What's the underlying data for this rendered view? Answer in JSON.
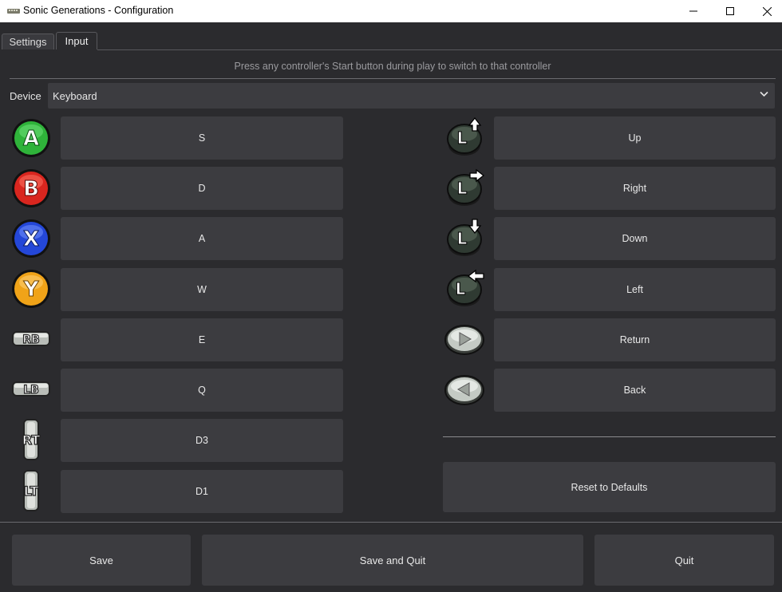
{
  "window": {
    "title": "Sonic Generations - Configuration"
  },
  "tabs": [
    {
      "label": "Settings"
    },
    {
      "label": "Input"
    }
  ],
  "hint": "Press any controller's Start button during play to switch to that controller",
  "device": {
    "label": "Device",
    "value": "Keyboard"
  },
  "left_bindings": [
    {
      "icon": "a-button-icon",
      "key": "S"
    },
    {
      "icon": "b-button-icon",
      "key": "D"
    },
    {
      "icon": "x-button-icon",
      "key": "A"
    },
    {
      "icon": "y-button-icon",
      "key": "W"
    },
    {
      "icon": "rb-bumper-icon",
      "key": "E"
    },
    {
      "icon": "lb-bumper-icon",
      "key": "Q"
    },
    {
      "icon": "rt-trigger-icon",
      "key": "D3"
    },
    {
      "icon": "lt-trigger-icon",
      "key": "D1"
    }
  ],
  "right_bindings": [
    {
      "icon": "left-stick-up-icon",
      "key": "Up"
    },
    {
      "icon": "left-stick-right-icon",
      "key": "Right"
    },
    {
      "icon": "left-stick-down-icon",
      "key": "Down"
    },
    {
      "icon": "left-stick-left-icon",
      "key": "Left"
    },
    {
      "icon": "start-button-icon",
      "key": "Return"
    },
    {
      "icon": "back-button-icon",
      "key": "Back"
    }
  ],
  "reset_label": "Reset to Defaults",
  "footer": {
    "save": "Save",
    "save_quit": "Save and Quit",
    "quit": "Quit"
  },
  "colors": {
    "a": "#2fb33a",
    "b": "#d9261f",
    "x": "#2447d8",
    "y": "#f0a318",
    "background": "#2b2b2e",
    "button": "#3c3c40"
  }
}
